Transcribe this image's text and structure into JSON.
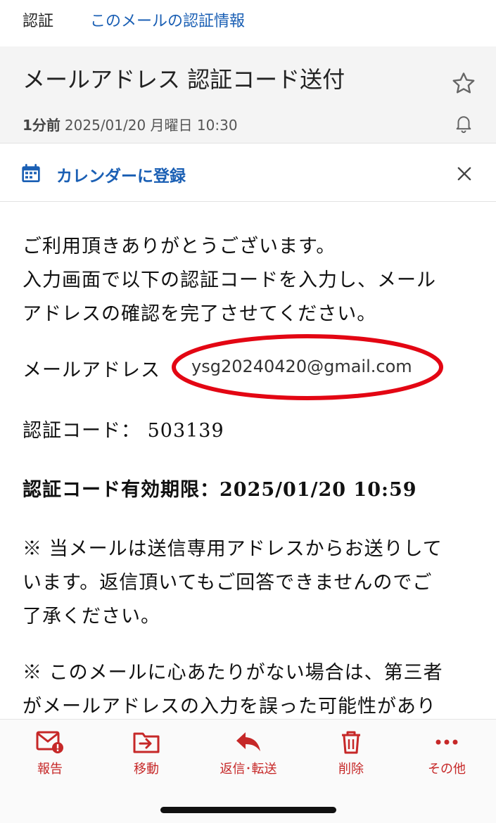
{
  "topnav": {
    "category": "認証",
    "auth_info_link": "このメールの認証情報"
  },
  "header": {
    "subject": "メールアドレス 認証コード送付",
    "time_ago": "1分前",
    "datetime": "2025/01/20 月曜日 10:30",
    "star_icon": "star-outline-icon",
    "bell_icon": "bell-outline-icon"
  },
  "calendar_bar": {
    "label": "カレンダーに登録",
    "icon": "calendar-icon",
    "close_icon": "close-icon"
  },
  "body": {
    "greeting": "ご利用頂きありがとうございます。",
    "instruction_1": "入力画面で以下の認証コードを入力し、メール",
    "instruction_2": "アドレスの確認を完了させてください。",
    "email_label": "メールアドレス",
    "email_value": "ysg20240420@gmail.com",
    "code_line": "認証コード： 503139",
    "expiry_line": "認証コード有効期限：2025/01/20 10:59",
    "note1_1": "※ 当メールは送信専用アドレスからお送りして",
    "note1_2": "います。返信頂いてもご回答できませんのでご",
    "note1_3": "了承ください。",
    "note2_1": "※ このメールに心あたりがない場合は、第三者",
    "note2_2": "がメールアドレスの入力を誤った可能性があり"
  },
  "annotation": {
    "highlight_color": "#e30613"
  },
  "toolbar": {
    "items": [
      {
        "label": "報告",
        "icon": "report-mail-icon"
      },
      {
        "label": "移動",
        "icon": "move-folder-icon"
      },
      {
        "label": "返信･転送",
        "icon": "reply-icon"
      },
      {
        "label": "削除",
        "icon": "trash-icon"
      },
      {
        "label": "その他",
        "icon": "more-icon"
      }
    ],
    "accent_color": "#c62828"
  }
}
